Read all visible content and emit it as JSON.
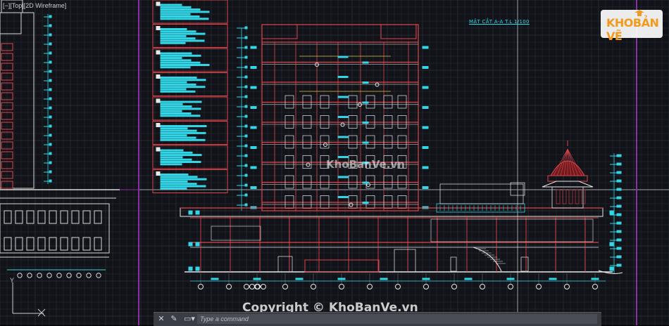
{
  "viewport": {
    "label": "[−][Top][2D Wireframe]"
  },
  "drawing": {
    "section_title": "MẶT CẮT A-A  T.L 1/100",
    "watermark_center": "KhoBanVe.vn",
    "copyright": "Copyright © KhoBanVe.vn"
  },
  "logo": {
    "part1": "KHO",
    "part2": "BẢN VẼ"
  },
  "command_line": {
    "placeholder": "Type a command",
    "close_icon": "close-icon",
    "settings_icon": "wrench-icon",
    "history_icon": "command-history-icon"
  },
  "ucs": {
    "y_label": "Y"
  },
  "colors": {
    "background": "#111318",
    "grid": "#1d2027",
    "grid_major": "#262a33",
    "outline": "#e0454b",
    "dimension": "#33d6e6",
    "white_line": "#e8e8e8",
    "yellow_line": "#d9c24a",
    "magenta_border": "#8a2fa6",
    "logo_orange": "#f29a1e"
  }
}
